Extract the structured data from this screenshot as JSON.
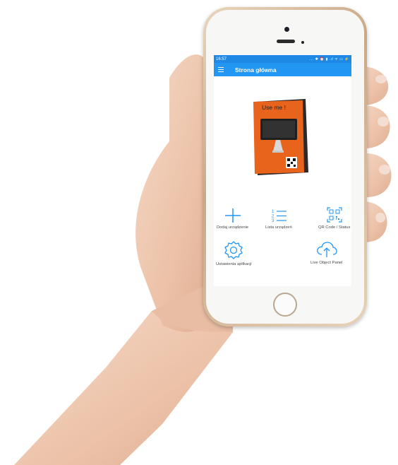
{
  "status_bar": {
    "time": "16:57",
    "icons": "... ✱ ⏰ ▮ .ıl ᯤ ▭ ⚡"
  },
  "app_bar": {
    "title": "Strona główna",
    "menu_icon": "hamburger-icon"
  },
  "device_image": {
    "label": "Use me !"
  },
  "menu": [
    {
      "label": "Dodaj urządzenie",
      "icon": "plus-icon"
    },
    {
      "label": "Lista urządzeń",
      "icon": "list-icon"
    },
    {
      "label": "QR Code / Status",
      "icon": "qr-code-icon"
    },
    {
      "label": "Ustawienia aplikacji",
      "icon": "gear-icon"
    },
    {
      "label": "Live Object Panel",
      "icon": "cloud-upload-icon"
    }
  ],
  "colors": {
    "primary": "#2196f3",
    "status_bar": "#1e88e5",
    "device_orange": "#e8641c"
  }
}
